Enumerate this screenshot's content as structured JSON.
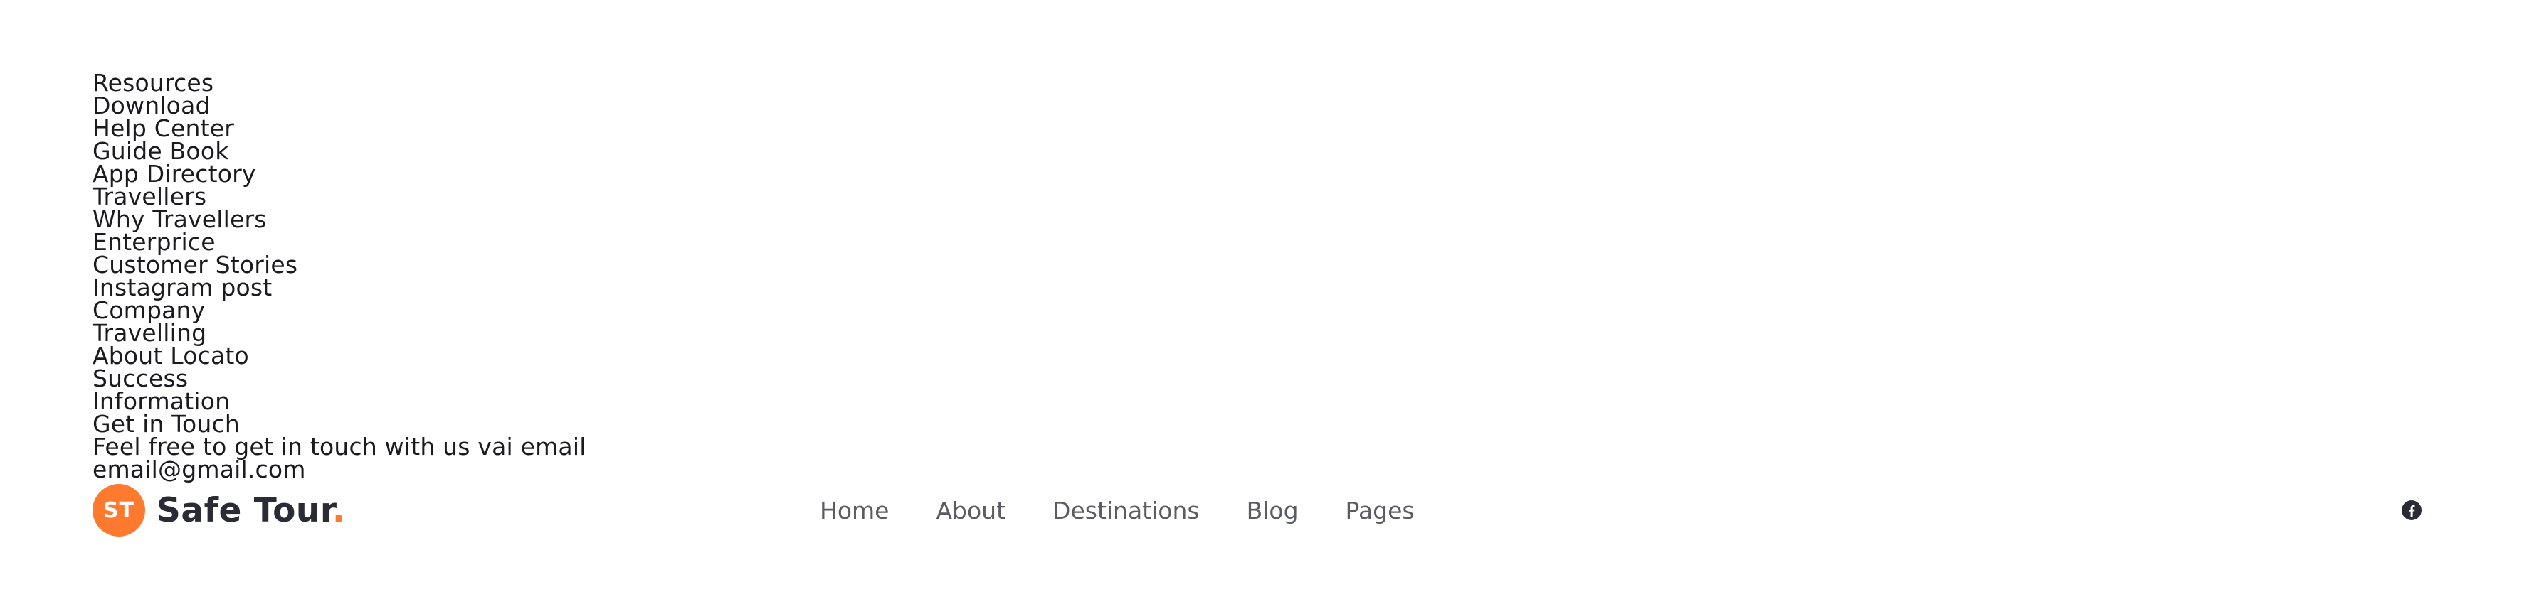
{
  "footer": {
    "resources": {
      "heading": "Resources",
      "items": [
        "Download",
        "Help Center",
        "Guide Book",
        "App Directory"
      ]
    },
    "travellers": {
      "heading": "Travellers",
      "items": [
        "Why Travellers",
        "Enterprice",
        "Customer Stories",
        "Instagram post"
      ]
    },
    "company": {
      "heading": "Company",
      "items": [
        "Travelling",
        "About Locato",
        "Success",
        "Information"
      ]
    },
    "contact": {
      "heading": "Get in Touch",
      "text": "Feel free to get in touch with us vai email",
      "email": "email@gmail.com"
    }
  },
  "header": {
    "logo": {
      "badge": "ST",
      "name": "Safe Tour",
      "dot": "."
    },
    "nav": [
      "Home",
      "About",
      "Destinations",
      "Blog",
      "Pages"
    ],
    "social": [
      "facebook-icon"
    ]
  },
  "colors": {
    "accent": "#ff7a2f",
    "text": "#1a1a1f",
    "nav_text": "#5a5b66",
    "logo_text": "#2a2b35"
  }
}
